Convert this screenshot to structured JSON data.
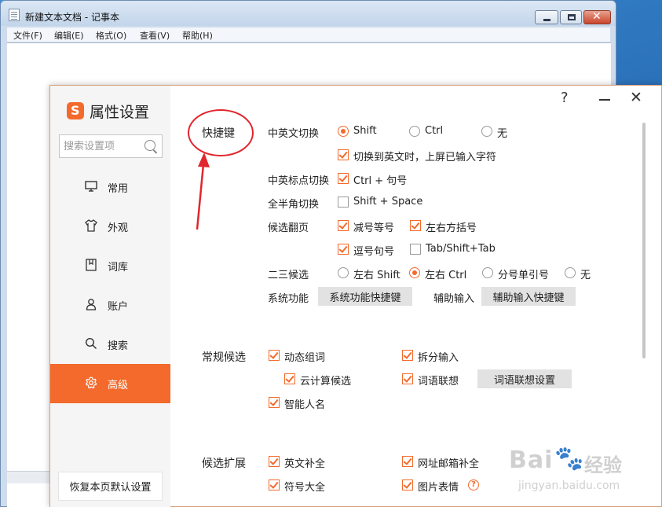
{
  "notepad": {
    "title": "新建文本文档 - 记事本",
    "menu": [
      "文件(F)",
      "编辑(E)",
      "格式(O)",
      "查看(V)",
      "帮助(H)"
    ]
  },
  "dialog": {
    "app_title": "属性设置",
    "search_placeholder": "搜索设置项",
    "help": "?",
    "nav": [
      {
        "label": "常用",
        "icon": "monitor-icon"
      },
      {
        "label": "外观",
        "icon": "shirt-icon"
      },
      {
        "label": "词库",
        "icon": "book-icon"
      },
      {
        "label": "账户",
        "icon": "user-icon"
      },
      {
        "label": "搜索",
        "icon": "search-icon"
      },
      {
        "label": "高级",
        "icon": "gear-icon",
        "active": true
      }
    ],
    "restore_label": "恢复本页默认设置"
  },
  "shortcuts": {
    "title": "快捷键",
    "cn_en_switch": {
      "label": "中英文切换",
      "options": [
        "Shift",
        "Ctrl",
        "无"
      ],
      "selected": "Shift",
      "sub_option": {
        "label": "切换到英文时，上屏已输入字符",
        "checked": true
      }
    },
    "punct_switch": {
      "label": "中英标点切换",
      "option": "Ctrl + 句号",
      "checked": true
    },
    "width_switch": {
      "label": "全半角切换",
      "option": "Shift + Space",
      "checked": false
    },
    "page_turn": {
      "label": "候选翻页",
      "options": [
        {
          "label": "减号等号",
          "checked": true
        },
        {
          "label": "左右方括号",
          "checked": true
        },
        {
          "label": "逗号句号",
          "checked": true
        },
        {
          "label": "Tab/Shift+Tab",
          "checked": false
        }
      ]
    },
    "second_third": {
      "label": "二三候选",
      "options": [
        "左右 Shift",
        "左右 Ctrl",
        "分号单引号",
        "无"
      ],
      "selected": "左右 Ctrl"
    },
    "system_func": {
      "label": "系统功能",
      "button": "系统功能快捷键"
    },
    "assist_input": {
      "label": "辅助输入",
      "button": "辅助输入快捷键"
    }
  },
  "general_candidates": {
    "title": "常规候选",
    "options": [
      {
        "label": "动态组词",
        "checked": true
      },
      {
        "label": "拆分输入",
        "checked": true
      },
      {
        "label": "云计算候选",
        "checked": true
      },
      {
        "label": "词语联想",
        "checked": true
      },
      {
        "label": "智能人名",
        "checked": true
      }
    ],
    "assoc_button": "词语联想设置"
  },
  "candidate_ext": {
    "title": "候选扩展",
    "options": [
      {
        "label": "英文补全",
        "checked": true
      },
      {
        "label": "网址邮箱补全",
        "checked": true
      },
      {
        "label": "符号大全",
        "checked": true
      },
      {
        "label": "图片表情",
        "checked": true
      }
    ]
  },
  "watermark": {
    "brand": "Bai",
    "brand_suffix": "经验",
    "url": "jingyan.baidu.com"
  },
  "colors": {
    "accent": "#f36a2c",
    "annotation": "#e1262d"
  }
}
